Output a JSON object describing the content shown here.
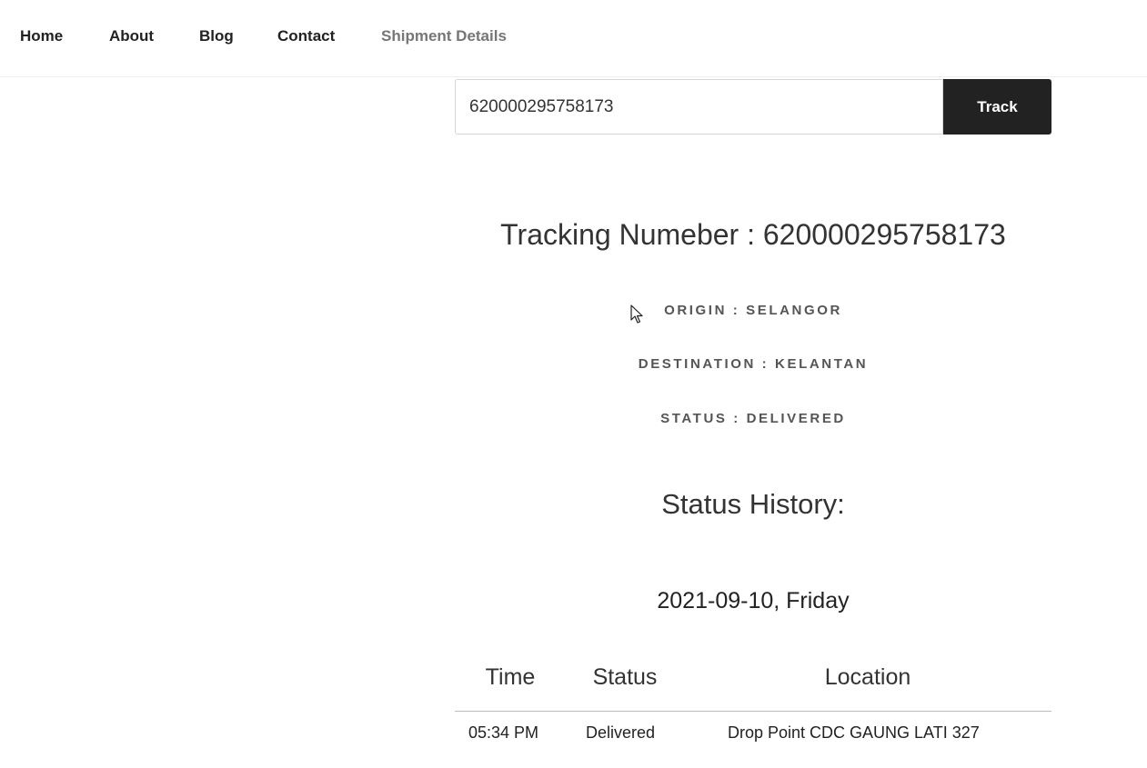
{
  "nav": {
    "items": [
      {
        "label": "Home"
      },
      {
        "label": "About"
      },
      {
        "label": "Blog"
      },
      {
        "label": "Contact"
      },
      {
        "label": "Shipment Details"
      }
    ]
  },
  "search": {
    "value": "620000295758173",
    "button_label": "Track"
  },
  "shipment": {
    "tracking_heading": "Tracking Numeber : 620000295758173",
    "origin": "ORIGIN : SELANGOR",
    "destination": "DESTINATION : KELANTAN",
    "status": "STATUS : DELIVERED"
  },
  "history": {
    "heading": "Status History:",
    "date": "2021-09-10, Friday",
    "columns": [
      "Time",
      "Status",
      "Location"
    ],
    "rows": [
      [
        "05:34 PM",
        "Delivered",
        "Drop Point CDC GAUNG LATI 327"
      ]
    ]
  },
  "icons": {
    "cursor": "mouse-pointer-icon"
  },
  "colors": {
    "button_bg": "#222222",
    "nav_current": "#767676"
  }
}
